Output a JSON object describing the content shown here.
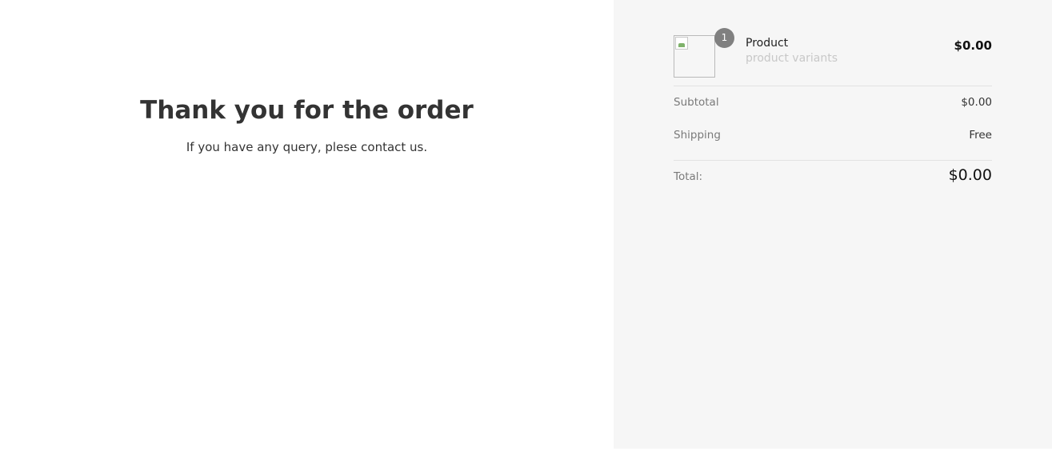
{
  "confirmation": {
    "title": "Thank you for the order",
    "message": "If you have any query, plese contact us."
  },
  "summary": {
    "item": {
      "quantity": "1",
      "name": "Product",
      "variants": "product variants",
      "price": "$0.00"
    },
    "subtotal_label": "Subtotal",
    "subtotal_value": "$0.00",
    "shipping_label": "Shipping",
    "shipping_value": "Free",
    "total_label": "Total:",
    "total_value": "$0.00"
  }
}
